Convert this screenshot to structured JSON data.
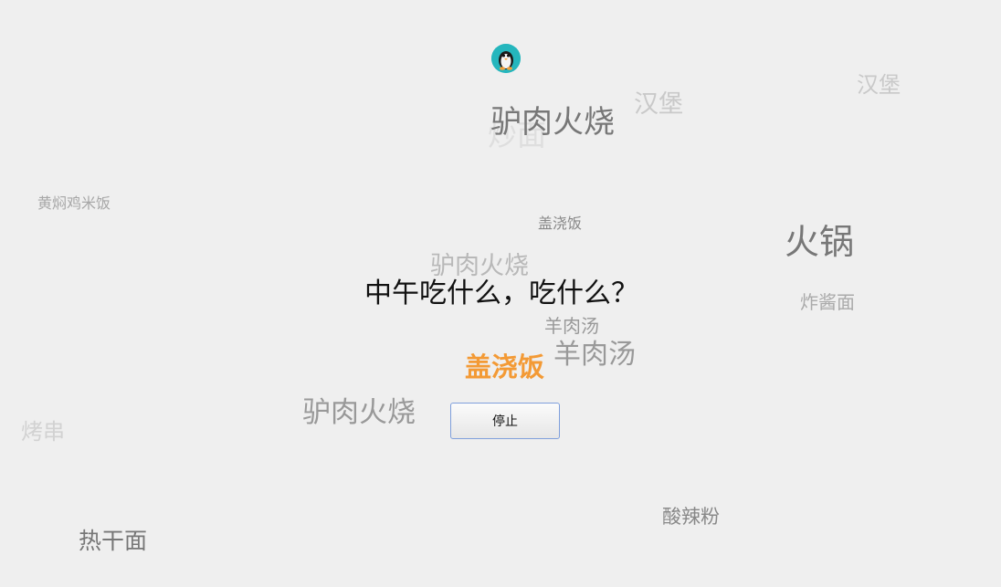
{
  "title": "中午吃什么，吃什么？",
  "result": "盖浇饭",
  "button": {
    "label": "停止"
  },
  "logo_icon": "penguin-icon",
  "floating_words": [
    {
      "text": "汉堡"
    },
    {
      "text": "汉堡"
    },
    {
      "text": "炒面"
    },
    {
      "text": "驴肉火烧"
    },
    {
      "text": "黄焖鸡米饭"
    },
    {
      "text": "盖浇饭"
    },
    {
      "text": "火锅"
    },
    {
      "text": "驴肉火烧"
    },
    {
      "text": "炸酱面"
    },
    {
      "text": "羊肉汤"
    },
    {
      "text": "羊肉汤"
    },
    {
      "text": "驴肉火烧"
    },
    {
      "text": "烤串"
    },
    {
      "text": "酸辣粉"
    },
    {
      "text": "热干面"
    }
  ],
  "colors": {
    "background": "#efefef",
    "accent": "#f39a35",
    "logo": "#25b6bd",
    "button_border": "#7f9fdc"
  }
}
